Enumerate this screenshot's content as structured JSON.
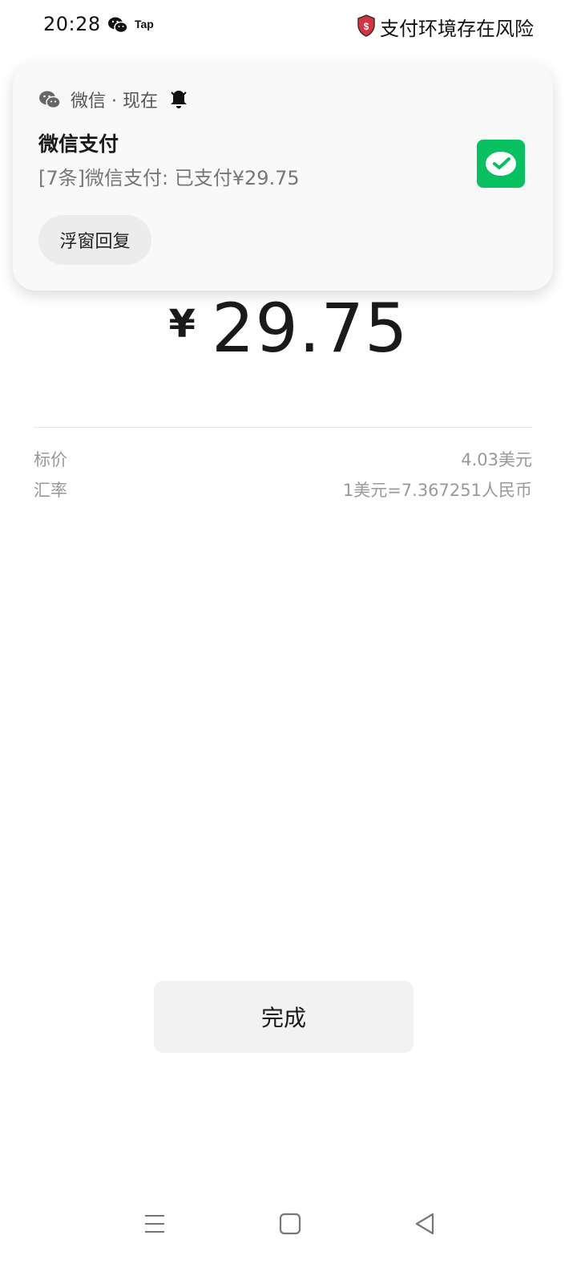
{
  "status_bar": {
    "time": "20:28",
    "app_label": "Tap",
    "risk_text": "支付环境存在风险"
  },
  "notification": {
    "app_name": "微信 · 现在",
    "title": "微信支付",
    "body": "[7条]微信支付: 已支付¥29.75",
    "reply_label": "浮窗回复"
  },
  "payment": {
    "currency_symbol": "¥",
    "amount": "29.75",
    "details": [
      {
        "label": "标价",
        "value": "4.03美元"
      },
      {
        "label": "汇率",
        "value": "1美元=7.367251人民币"
      }
    ],
    "done_label": "完成"
  },
  "colors": {
    "wechat_green": "#07c160",
    "risk_red": "#d9333f"
  }
}
